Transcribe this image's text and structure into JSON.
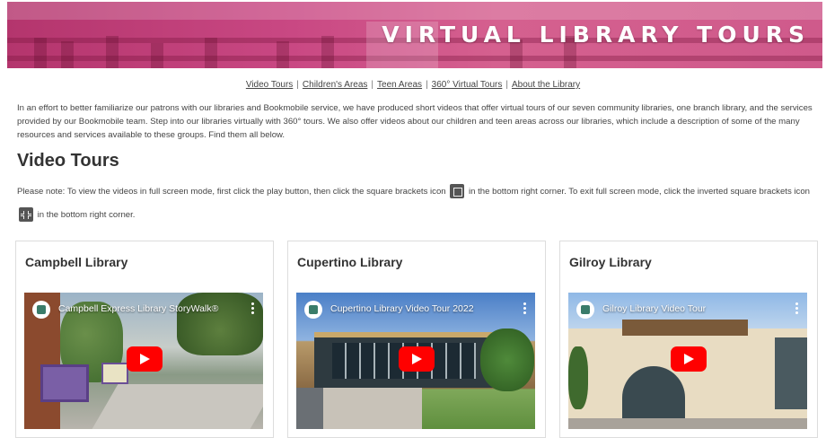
{
  "banner": {
    "title": "VIRTUAL LIBRARY TOURS"
  },
  "nav": [
    {
      "label": "Video Tours"
    },
    {
      "label": "Children's Areas"
    },
    {
      "label": "Teen Areas"
    },
    {
      "label": "360° Virtual Tours"
    },
    {
      "label": "About the Library"
    }
  ],
  "intro": "In an effort to better familiarize our patrons with our libraries and Bookmobile service, we have produced short videos that offer virtual tours of our seven community libraries, one branch library, and the services provided by our Bookmobile team. Step into our libraries virtually with 360° tours. We also offer videos about our children and teen areas across our libraries, which include a description of some of the many resources and services available to these groups. Find them all below.",
  "section_title": "Video Tours",
  "note": {
    "part1": "Please note: To view the videos in full screen mode, first click the play button, then click the square brackets icon",
    "part2": "in the bottom right corner. To exit full screen mode, click the inverted square brackets icon",
    "part3": "in the bottom right corner."
  },
  "cards": [
    {
      "name": "Campbell Library",
      "video_title": "Campbell Express Library StoryWalk®"
    },
    {
      "name": "Cupertino Library",
      "video_title": "Cupertino Library Video Tour 2022"
    },
    {
      "name": "Gilroy Library",
      "video_title": "Gilroy Library Video Tour"
    }
  ],
  "colors": {
    "banner": "#c94883",
    "play": "#ff0000"
  }
}
